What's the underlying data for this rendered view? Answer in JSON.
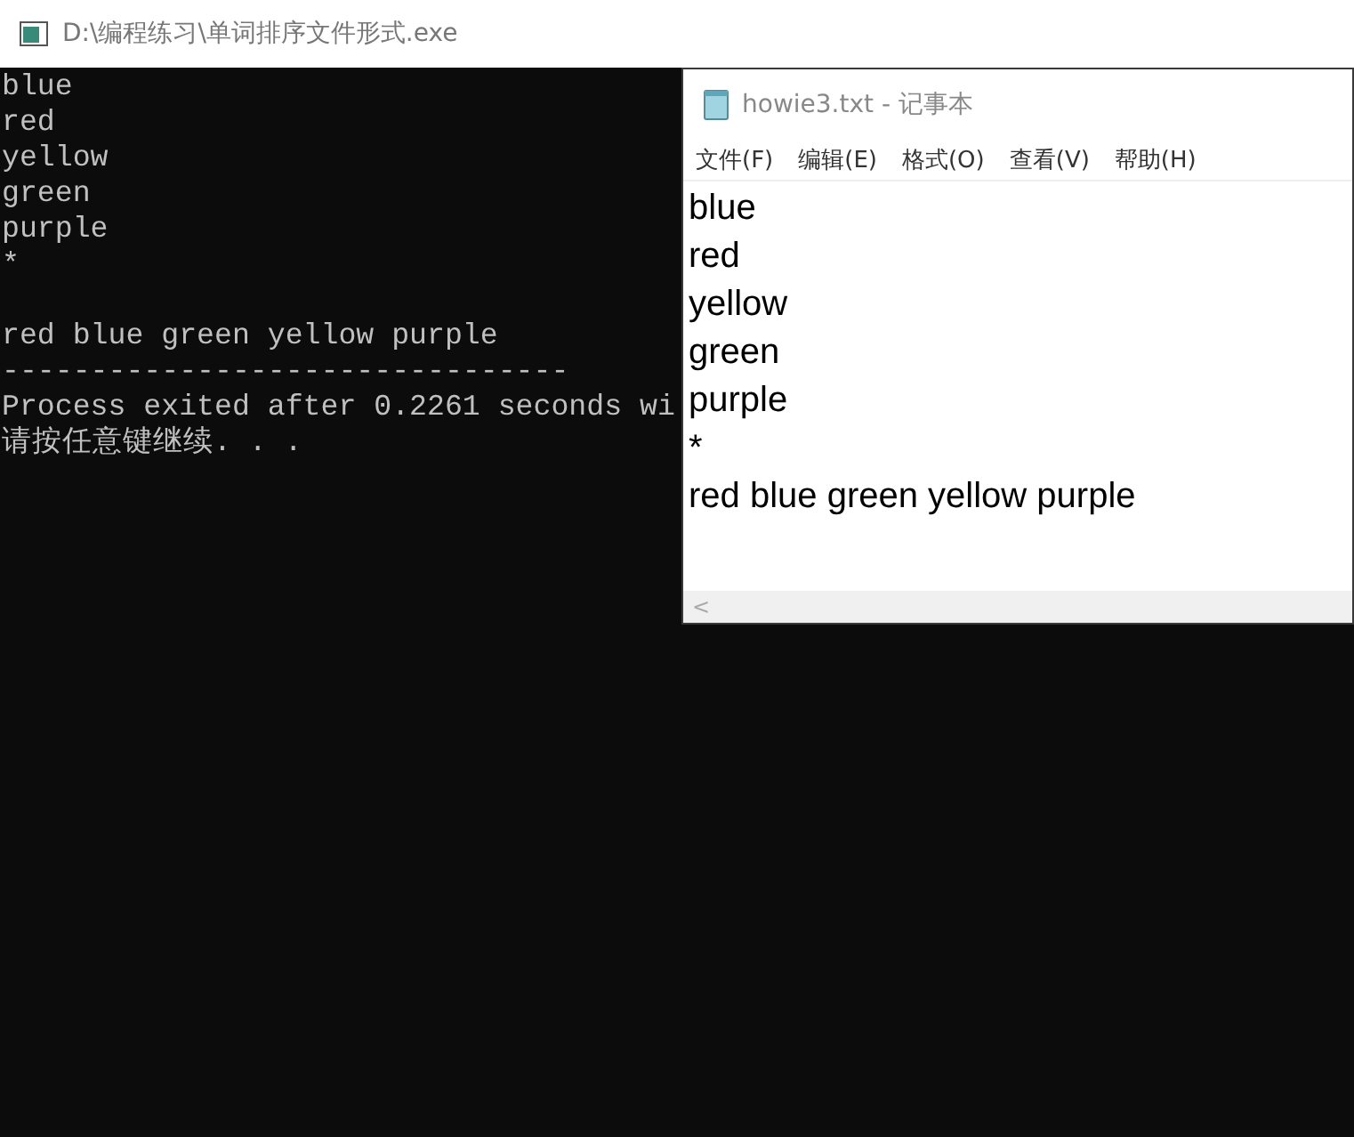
{
  "console": {
    "title": "D:\\编程练习\\单词排序文件形式.exe",
    "blocks": [
      {
        "lines": [
          "blue",
          "red",
          "yellow",
          "green",
          "purple",
          "*"
        ]
      },
      {
        "lines": [
          "red blue green yellow purple",
          "--------------------------------",
          "Process exited after 0.2261 seconds wi",
          "请按任意键继续. . ."
        ]
      }
    ]
  },
  "notepad": {
    "title": "howie3.txt - 记事本",
    "menu": [
      "文件(F)",
      "编辑(E)",
      "格式(O)",
      "查看(V)",
      "帮助(H)"
    ],
    "lines": [
      "blue",
      "red",
      "yellow",
      "green",
      "purple",
      "*",
      "red blue green yellow purple"
    ],
    "scroll_arrow": "<"
  }
}
